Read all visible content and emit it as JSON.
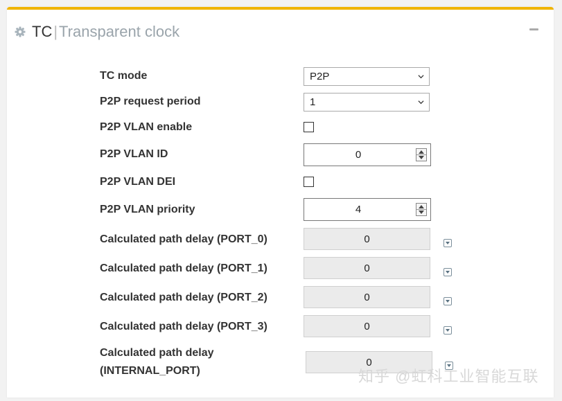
{
  "header": {
    "abbr": "TC",
    "separator": "|",
    "full_title": "Transparent clock"
  },
  "fields": {
    "tc_mode": {
      "label": "TC mode",
      "value": "P2P"
    },
    "p2p_request_period": {
      "label": "P2P request period",
      "value": "1"
    },
    "p2p_vlan_enable": {
      "label": "P2P VLAN enable",
      "checked": false
    },
    "p2p_vlan_id": {
      "label": "P2P VLAN ID",
      "value": "0"
    },
    "p2p_vlan_dei": {
      "label": "P2P VLAN DEI",
      "checked": false
    },
    "p2p_vlan_priority": {
      "label": "P2P VLAN priority",
      "value": "4"
    },
    "delay_port_0": {
      "label": "Calculated path delay (PORT_0)",
      "value": "0"
    },
    "delay_port_1": {
      "label": "Calculated path delay (PORT_1)",
      "value": "0"
    },
    "delay_port_2": {
      "label": "Calculated path delay (PORT_2)",
      "value": "0"
    },
    "delay_port_3": {
      "label": "Calculated path delay (PORT_3)",
      "value": "0"
    },
    "delay_internal": {
      "label_line1": "Calculated path delay",
      "label_line2": "(INTERNAL_PORT)",
      "value": "0"
    }
  },
  "watermark": "知乎 @虹科工业智能互联",
  "colors": {
    "accent": "#f0b400",
    "readonly_bg": "#ebebeb"
  },
  "icons": {
    "header": "gear-icon",
    "collapse": "minus-icon",
    "select": "chevron-down-icon",
    "readonly_action": "dropdown-square-icon"
  }
}
